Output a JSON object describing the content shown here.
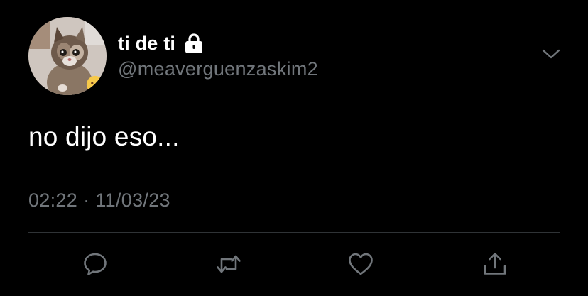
{
  "tweet": {
    "author": {
      "display_name": "ti de ti",
      "handle": "@meaverguenzaskim2",
      "protected_icon": "lock-icon",
      "avatar_badge_icon": "frowning-face-emoji"
    },
    "text": "no dijo eso...",
    "time": "02:22",
    "separator": "·",
    "date": "11/03/23"
  },
  "actions": [
    {
      "name": "reply",
      "icon": "speech-bubble-icon"
    },
    {
      "name": "retweet",
      "icon": "retweet-icon"
    },
    {
      "name": "like",
      "icon": "heart-icon"
    },
    {
      "name": "share",
      "icon": "share-icon"
    }
  ],
  "colors": {
    "background": "#000000",
    "primary_text": "#ffffff",
    "secondary_text": "#71767b",
    "divider": "#2f3336"
  }
}
